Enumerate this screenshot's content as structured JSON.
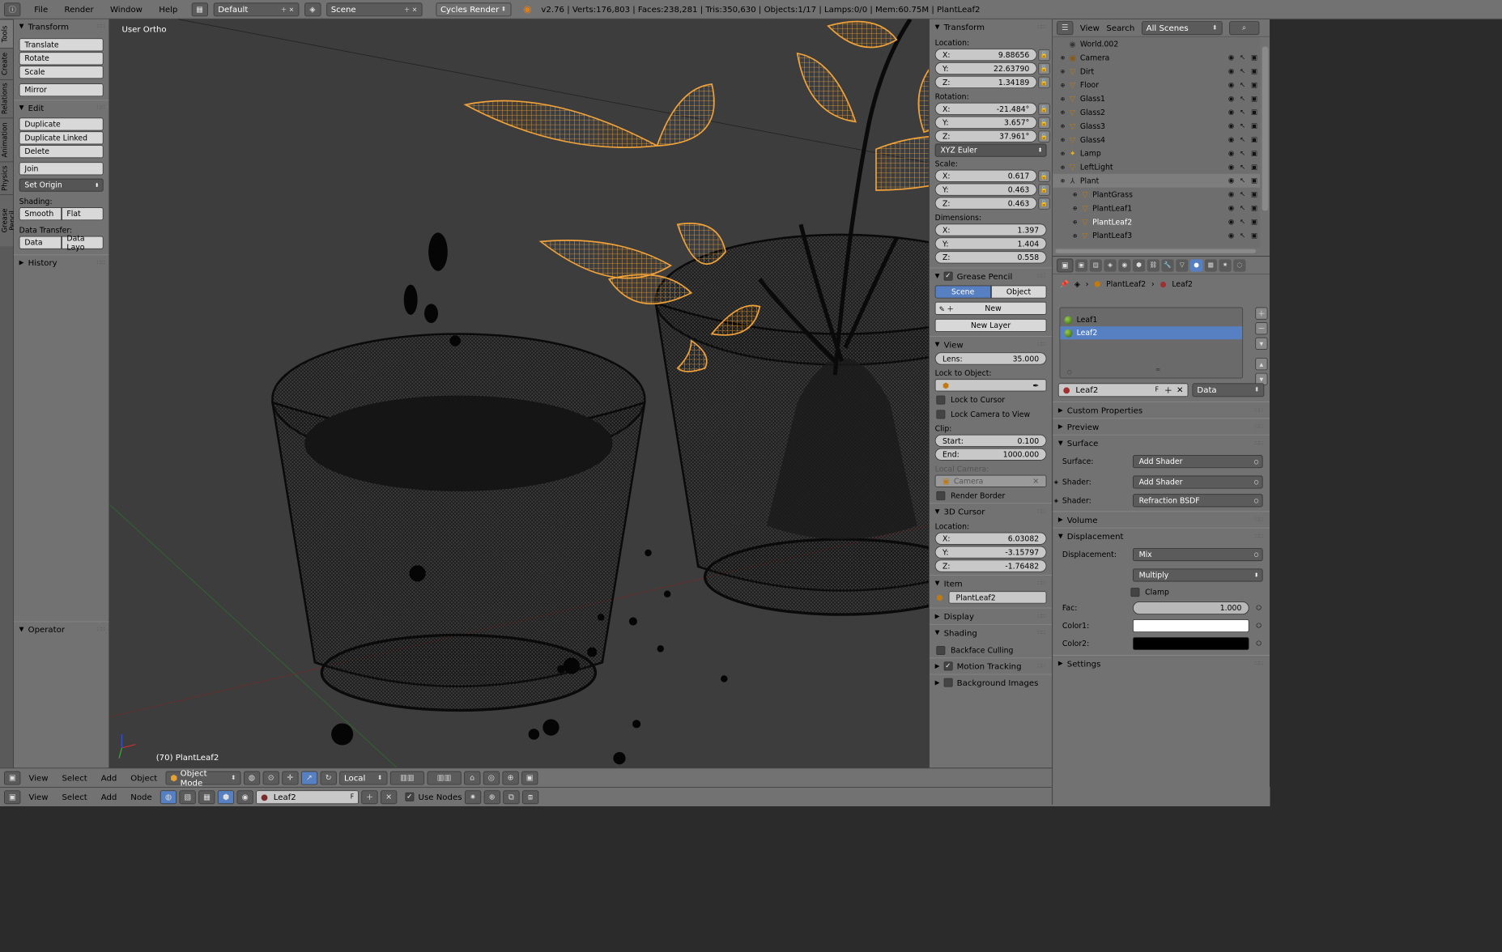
{
  "topbar": {
    "info_icon": "info-icon",
    "menus": [
      "File",
      "Render",
      "Window",
      "Help"
    ],
    "screen_layout": "Default",
    "scene": "Scene",
    "engine": "Cycles Render",
    "stats": "v2.76 | Verts:176,803 | Faces:238,281 | Tris:350,630 | Objects:1/17 | Lamps:0/0 | Mem:60.75M | PlantLeaf2"
  },
  "tabs": [
    "Tools",
    "Create",
    "Relations",
    "Animation",
    "Physics",
    "Grease Pencil"
  ],
  "toolshelf": {
    "transform_title": "Transform",
    "translate": "Translate",
    "rotate": "Rotate",
    "scale": "Scale",
    "mirror": "Mirror",
    "edit_title": "Edit",
    "duplicate": "Duplicate",
    "duplicate_linked": "Duplicate Linked",
    "delete": "Delete",
    "join": "Join",
    "set_origin": "Set Origin",
    "shading_label": "Shading:",
    "smooth": "Smooth",
    "flat": "Flat",
    "data_transfer_label": "Data Transfer:",
    "data": "Data",
    "data_layout": "Data Layo",
    "history_title": "History",
    "operator_title": "Operator"
  },
  "viewport": {
    "view_name": "User Ortho",
    "active_object": "(70) PlantLeaf2"
  },
  "view3d_header": {
    "menus": [
      "View",
      "Select",
      "Add",
      "Object"
    ],
    "mode": "Object Mode",
    "orientation": "Local"
  },
  "node_header": {
    "menus": [
      "View",
      "Select",
      "Add",
      "Node"
    ],
    "material": "Leaf2",
    "fake_user": "F",
    "use_nodes": "Use Nodes"
  },
  "npanel": {
    "transform_title": "Transform",
    "location_label": "Location:",
    "loc": [
      {
        "k": "X:",
        "v": "9.88656"
      },
      {
        "k": "Y:",
        "v": "22.63790"
      },
      {
        "k": "Z:",
        "v": "1.34189"
      }
    ],
    "rotation_label": "Rotation:",
    "rot": [
      {
        "k": "X:",
        "v": "-21.484°"
      },
      {
        "k": "Y:",
        "v": "3.657°"
      },
      {
        "k": "Z:",
        "v": "37.961°"
      }
    ],
    "rotation_mode": "XYZ Euler",
    "scale_label": "Scale:",
    "scl": [
      {
        "k": "X:",
        "v": "0.617"
      },
      {
        "k": "Y:",
        "v": "0.463"
      },
      {
        "k": "Z:",
        "v": "0.463"
      }
    ],
    "dimensions_label": "Dimensions:",
    "dim": [
      {
        "k": "X:",
        "v": "1.397"
      },
      {
        "k": "Y:",
        "v": "1.404"
      },
      {
        "k": "Z:",
        "v": "0.558"
      }
    ],
    "grease_pencil_title": "Grease Pencil",
    "gp_scene": "Scene",
    "gp_object": "Object",
    "gp_new": "New",
    "gp_new_layer": "New Layer",
    "view_title": "View",
    "lens_k": "Lens:",
    "lens_v": "35.000",
    "lock_object_label": "Lock to Object:",
    "lock_cursor": "Lock to Cursor",
    "lock_camera": "Lock Camera to View",
    "clip_label": "Clip:",
    "clip_start_k": "Start:",
    "clip_start_v": "0.100",
    "clip_end_k": "End:",
    "clip_end_v": "1000.000",
    "local_camera_label": "Local Camera:",
    "local_camera": "Camera",
    "render_border": "Render Border",
    "cursor_title": "3D Cursor",
    "cursor_location_label": "Location:",
    "cur": [
      {
        "k": "X:",
        "v": "6.03082"
      },
      {
        "k": "Y:",
        "v": "-3.15797"
      },
      {
        "k": "Z:",
        "v": "-1.76482"
      }
    ],
    "item_title": "Item",
    "item_name": "PlantLeaf2",
    "display_title": "Display",
    "shading_title": "Shading",
    "backface_culling": "Backface Culling",
    "motion_tracking": "Motion Tracking",
    "background_images": "Background Images"
  },
  "outliner": {
    "menus": [
      "View",
      "Search"
    ],
    "filter": "All Scenes",
    "rows": [
      {
        "name": "World.002",
        "icon": "world-icon",
        "indent": 1
      },
      {
        "name": "Camera",
        "icon": "camera-icon",
        "indent": 1
      },
      {
        "name": "Dirt",
        "icon": "mesh-icon",
        "indent": 1
      },
      {
        "name": "Floor",
        "icon": "mesh-icon",
        "indent": 1
      },
      {
        "name": "Glass1",
        "icon": "mesh-icon",
        "indent": 1
      },
      {
        "name": "Glass2",
        "icon": "mesh-icon",
        "indent": 1
      },
      {
        "name": "Glass3",
        "icon": "mesh-icon",
        "indent": 1
      },
      {
        "name": "Glass4",
        "icon": "mesh-icon",
        "indent": 1
      },
      {
        "name": "Lamp",
        "icon": "lamp-icon",
        "indent": 1
      },
      {
        "name": "LeftLight",
        "icon": "mesh-icon",
        "indent": 1
      },
      {
        "name": "Plant",
        "icon": "empty-icon",
        "indent": 1
      },
      {
        "name": "PlantGrass",
        "icon": "mesh-icon",
        "indent": 2
      },
      {
        "name": "PlantLeaf1",
        "icon": "mesh-icon",
        "indent": 2
      },
      {
        "name": "PlantLeaf2",
        "icon": "mesh-icon",
        "indent": 2
      },
      {
        "name": "PlantLeaf3",
        "icon": "mesh-icon",
        "indent": 2
      }
    ]
  },
  "properties": {
    "breadcrumb_object": "PlantLeaf2",
    "breadcrumb_material": "Leaf2",
    "materials": [
      "Leaf1",
      "Leaf2"
    ],
    "material_name": "Leaf2",
    "fake_user": "F",
    "link": "Data",
    "custom_properties": "Custom Properties",
    "preview": "Preview",
    "surface_title": "Surface",
    "surface_label": "Surface:",
    "surface_value": "Add Shader",
    "shader1_label": "Shader:",
    "shader1_value": "Add Shader",
    "shader2_label": "Shader:",
    "shader2_value": "Refraction BSDF",
    "volume": "Volume",
    "displacement_title": "Displacement",
    "displacement_label": "Displacement:",
    "displacement_value": "Mix",
    "blend_mode": "Multiply",
    "clamp": "Clamp",
    "fac_label": "Fac:",
    "fac_value": "1.000",
    "color1_label": "Color1:",
    "color1": "#ffffff",
    "color2_label": "Color2:",
    "color2": "#000000",
    "settings": "Settings"
  },
  "colors": {
    "selection": "#5680c2",
    "wire_selected": "#f0a23a",
    "panel": "#727272",
    "viewport": "#3d3d3d"
  }
}
